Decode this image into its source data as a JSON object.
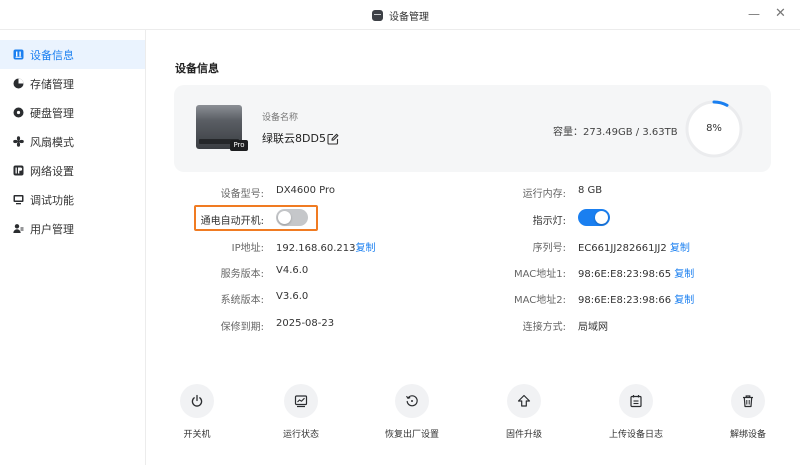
{
  "window": {
    "title": "设备管理"
  },
  "sidebar": {
    "items": [
      {
        "label": "设备信息",
        "icon": "device-info-icon",
        "active": true
      },
      {
        "label": "存储管理",
        "icon": "pie-chart-icon",
        "active": false
      },
      {
        "label": "硬盘管理",
        "icon": "disk-icon",
        "active": false
      },
      {
        "label": "风扇模式",
        "icon": "fan-icon",
        "active": false
      },
      {
        "label": "网络设置",
        "icon": "ip-icon",
        "active": false
      },
      {
        "label": "调试功能",
        "icon": "monitor-icon",
        "active": false
      },
      {
        "label": "用户管理",
        "icon": "users-icon",
        "active": false
      }
    ]
  },
  "main": {
    "section_title": "设备信息",
    "card": {
      "name_label": "设备名称",
      "device_name": "绿联云8DD5",
      "badge": "Pro",
      "capacity_label": "容量：",
      "capacity_value": "273.49GB / 3.63TB",
      "usage_percent_text": "8%",
      "usage_fraction": 0.08
    },
    "left_info": [
      {
        "label": "设备型号:",
        "value": "DX4600 Pro"
      },
      {
        "label": "通电自动开机:",
        "toggle": false
      },
      {
        "label": "IP地址:",
        "value": "192.168.60.213",
        "copy": "复制"
      },
      {
        "label": "服务版本:",
        "value": "V4.6.0"
      },
      {
        "label": "系统版本:",
        "value": "V3.6.0"
      },
      {
        "label": "保修到期:",
        "value": "2025-08-23"
      }
    ],
    "right_info": [
      {
        "label": "运行内存:",
        "value": "8 GB"
      },
      {
        "label": "指示灯:",
        "toggle": true
      },
      {
        "label": "序列号:",
        "value": "EC661JJ282661JJ2",
        "copy": "复制"
      },
      {
        "label": "MAC地址1:",
        "value": "98:6E:E8:23:98:65",
        "copy": "复制"
      },
      {
        "label": "MAC地址2:",
        "value": "98:6E:E8:23:98:66",
        "copy": "复制"
      },
      {
        "label": "连接方式:",
        "value": "局域网"
      }
    ],
    "actions": [
      {
        "label": "开关机",
        "icon": "power-icon"
      },
      {
        "label": "运行状态",
        "icon": "activity-icon"
      },
      {
        "label": "恢复出厂设置",
        "icon": "restore-icon"
      },
      {
        "label": "固件升级",
        "icon": "upgrade-icon"
      },
      {
        "label": "上传设备日志",
        "icon": "log-icon"
      },
      {
        "label": "解绑设备",
        "icon": "trash-icon"
      }
    ]
  },
  "colors": {
    "accent": "#1a7ff0",
    "highlight": "#f07b22",
    "toggle_off": "#c5c7ca"
  }
}
